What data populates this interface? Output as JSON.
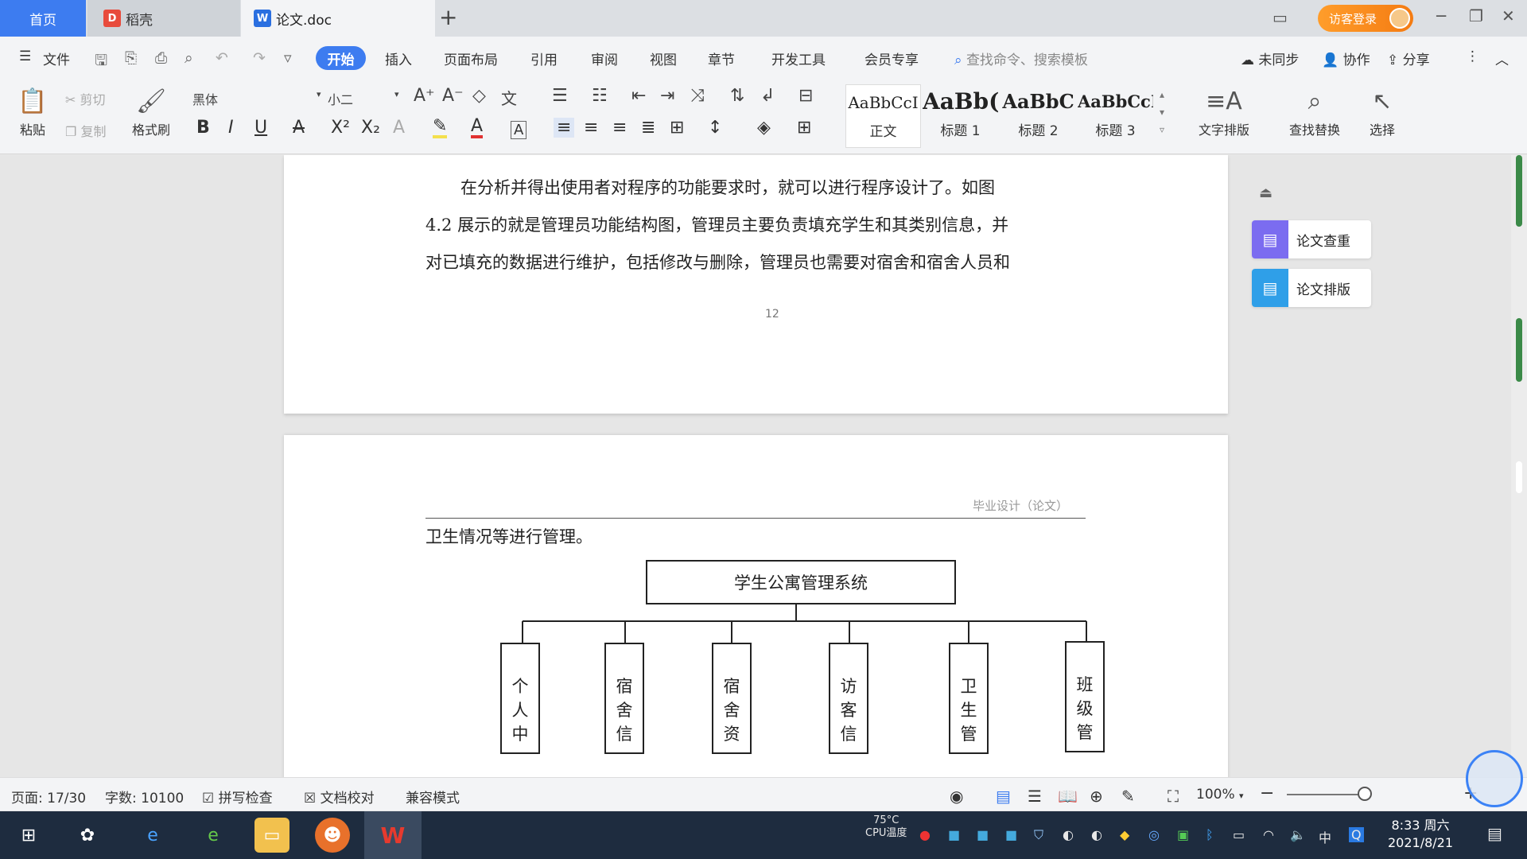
{
  "titlebar": {
    "tabs": [
      {
        "label": "首页"
      },
      {
        "label": "稻壳"
      },
      {
        "label": "论文.doc"
      }
    ],
    "add_tab": "+",
    "visitor_login": "访客登录",
    "win_controls": [
      "─",
      "❐",
      "✕"
    ]
  },
  "menubar": {
    "file": "文件",
    "items": [
      "开始",
      "插入",
      "页面布局",
      "引用",
      "审阅",
      "视图",
      "章节",
      "开发工具",
      "会员专享"
    ],
    "search_placeholder": "查找命令、搜索模板",
    "sync": "未同步",
    "collab": "协作",
    "share": "分享"
  },
  "ribbon": {
    "paste": "粘贴",
    "cut": "剪切",
    "copy": "复制",
    "format_painter": "格式刷",
    "font_name": "黑体",
    "font_size": "小二",
    "styles": [
      {
        "sample": "AaBbCcI",
        "name": "正文"
      },
      {
        "sample": "AaBb(",
        "name": "标题 1"
      },
      {
        "sample": "AaBbC",
        "name": "标题 2"
      },
      {
        "sample": "AaBbCcI",
        "name": "标题 3"
      }
    ],
    "text_layout": "文字排版",
    "find_replace": "查找替换",
    "select": "选择"
  },
  "document": {
    "page1_lines": [
      "在分析并得出使用者对程序的功能要求时，就可以进行程序设计了。如图",
      "4.2 展示的就是管理员功能结构图，管理员主要负责填充学生和其类别信息，并",
      "对已填充的数据进行维护，包括修改与删除，管理员也需要对宿舍和宿舍人员和"
    ],
    "page_number": "12",
    "header_text": "毕业设计（论文）",
    "page2_first_line": "卫生情况等进行管理。",
    "diagram": {
      "root": "学生公寓管理系统",
      "children": [
        "个人中",
        "宿舍信",
        "宿舍资",
        "访客信",
        "卫生管",
        "班级管"
      ]
    }
  },
  "side_panel": {
    "buttons": [
      {
        "label": "论文查重",
        "color": "#7b6cf0"
      },
      {
        "label": "论文排版",
        "color": "#2f9fe8"
      }
    ]
  },
  "statusbar": {
    "page": "页面: 17/30",
    "word_count": "字数: 10100",
    "spell_check": "拼写检查",
    "doc_proof": "文档校对",
    "compat_mode": "兼容模式",
    "zoom": "100%"
  },
  "taskbar": {
    "cpu_temp": "75°C",
    "cpu_label": "CPU温度",
    "ime": "中",
    "time": "8:33 周六",
    "date": "2021/8/21"
  },
  "colors": {
    "accent": "#3d7cf0",
    "visitor_btn": "#f47b12",
    "taskbar": "#1e2c3f"
  }
}
